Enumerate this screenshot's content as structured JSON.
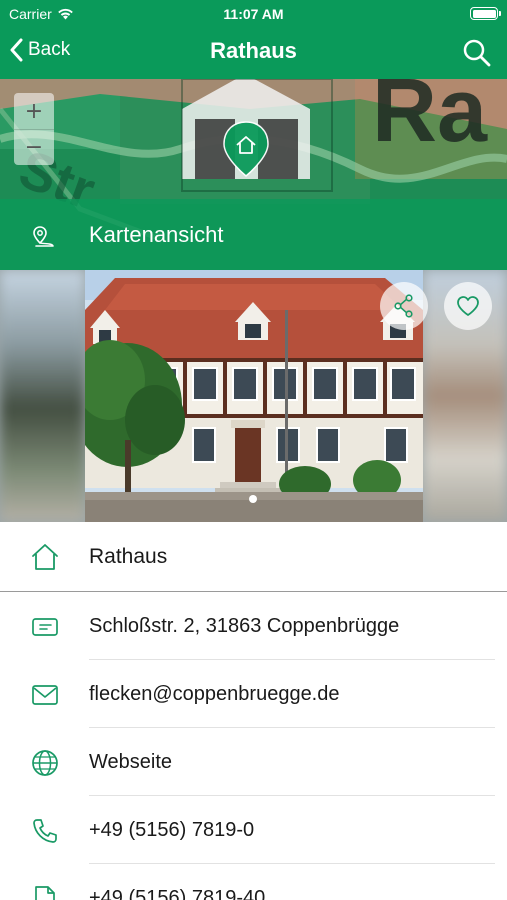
{
  "status_bar": {
    "carrier": "Carrier",
    "time": "11:07 AM"
  },
  "nav": {
    "back_label": "Back",
    "title": "Rathaus"
  },
  "map": {
    "zoom_in": "+",
    "zoom_out": "−",
    "label": "Kartenansicht"
  },
  "photo": {
    "page_count": 1,
    "current_page": 1
  },
  "details": {
    "title": "Rathaus",
    "address": "Schloßstr. 2, 31863 Coppenbrügge",
    "email": "flecken@coppenbruegge.de",
    "website": "Webseite",
    "phone": "+49 (5156) 7819-0",
    "fax": "+49 (5156) 7819-40"
  },
  "colors": {
    "brand_green": "#0a9a5a",
    "icon_green": "#1a9a66"
  }
}
